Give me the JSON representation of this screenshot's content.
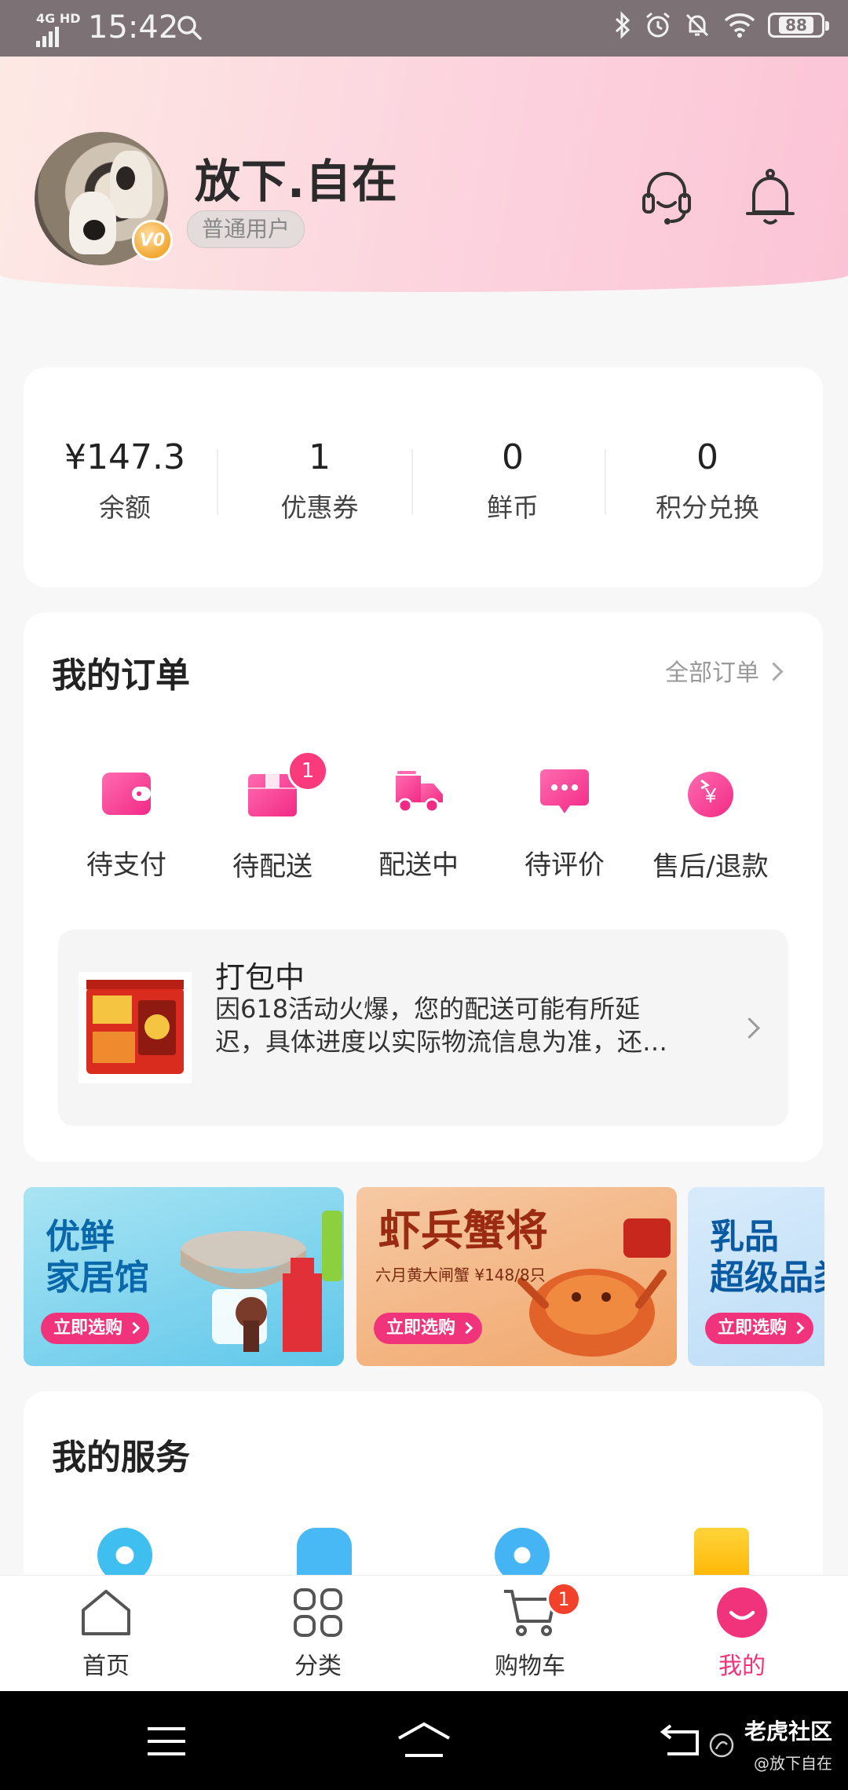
{
  "status_bar": {
    "network": "4G HD",
    "time": "15:42",
    "battery": "88"
  },
  "profile": {
    "name": "放下.自在",
    "level_tag": "普通用户",
    "vip_badge": "V0"
  },
  "assets": [
    {
      "value": "¥147.3",
      "label": "余额"
    },
    {
      "value": "1",
      "label": "优惠券"
    },
    {
      "value": "0",
      "label": "鲜币"
    },
    {
      "value": "0",
      "label": "积分兑换"
    }
  ],
  "orders": {
    "title": "我的订单",
    "all_label": "全部订单",
    "items": [
      {
        "label": "待支付",
        "icon": "wallet-icon"
      },
      {
        "label": "待配送",
        "icon": "package-icon",
        "badge": "1"
      },
      {
        "label": "配送中",
        "icon": "delivery-truck-icon"
      },
      {
        "label": "待评价",
        "icon": "comment-icon"
      },
      {
        "label": "售后/退款",
        "icon": "refund-icon"
      }
    ],
    "packing": {
      "title": "打包中",
      "desc_line1": "因618活动火爆，您的配送可能有所延",
      "desc_line2": "迟，具体进度以实际物流信息为准，还…"
    }
  },
  "banners": [
    {
      "title_l1": "优鲜",
      "title_l2": "家居馆",
      "button": "立即选购"
    },
    {
      "title": "虾兵蟹将",
      "subtitle": "六月黄大闸蟹 ¥148/8只",
      "button": "立即选购"
    },
    {
      "title_l1": "乳品",
      "title_l2": "超级品类",
      "button": "立即选购"
    }
  ],
  "services": {
    "title": "我的服务"
  },
  "bottom_nav": [
    {
      "label": "首页",
      "icon": "home-icon"
    },
    {
      "label": "分类",
      "icon": "category-icon"
    },
    {
      "label": "购物车",
      "icon": "cart-icon",
      "badge": "1"
    },
    {
      "label": "我的",
      "icon": "profile-icon",
      "active": true
    }
  ],
  "watermark": {
    "line1": "老虎社区",
    "line2": "@放下自在"
  },
  "colors": {
    "accent": "#f0337a",
    "badge": "#fa3a7b",
    "header_gradient_end": "#fbc4d6"
  }
}
